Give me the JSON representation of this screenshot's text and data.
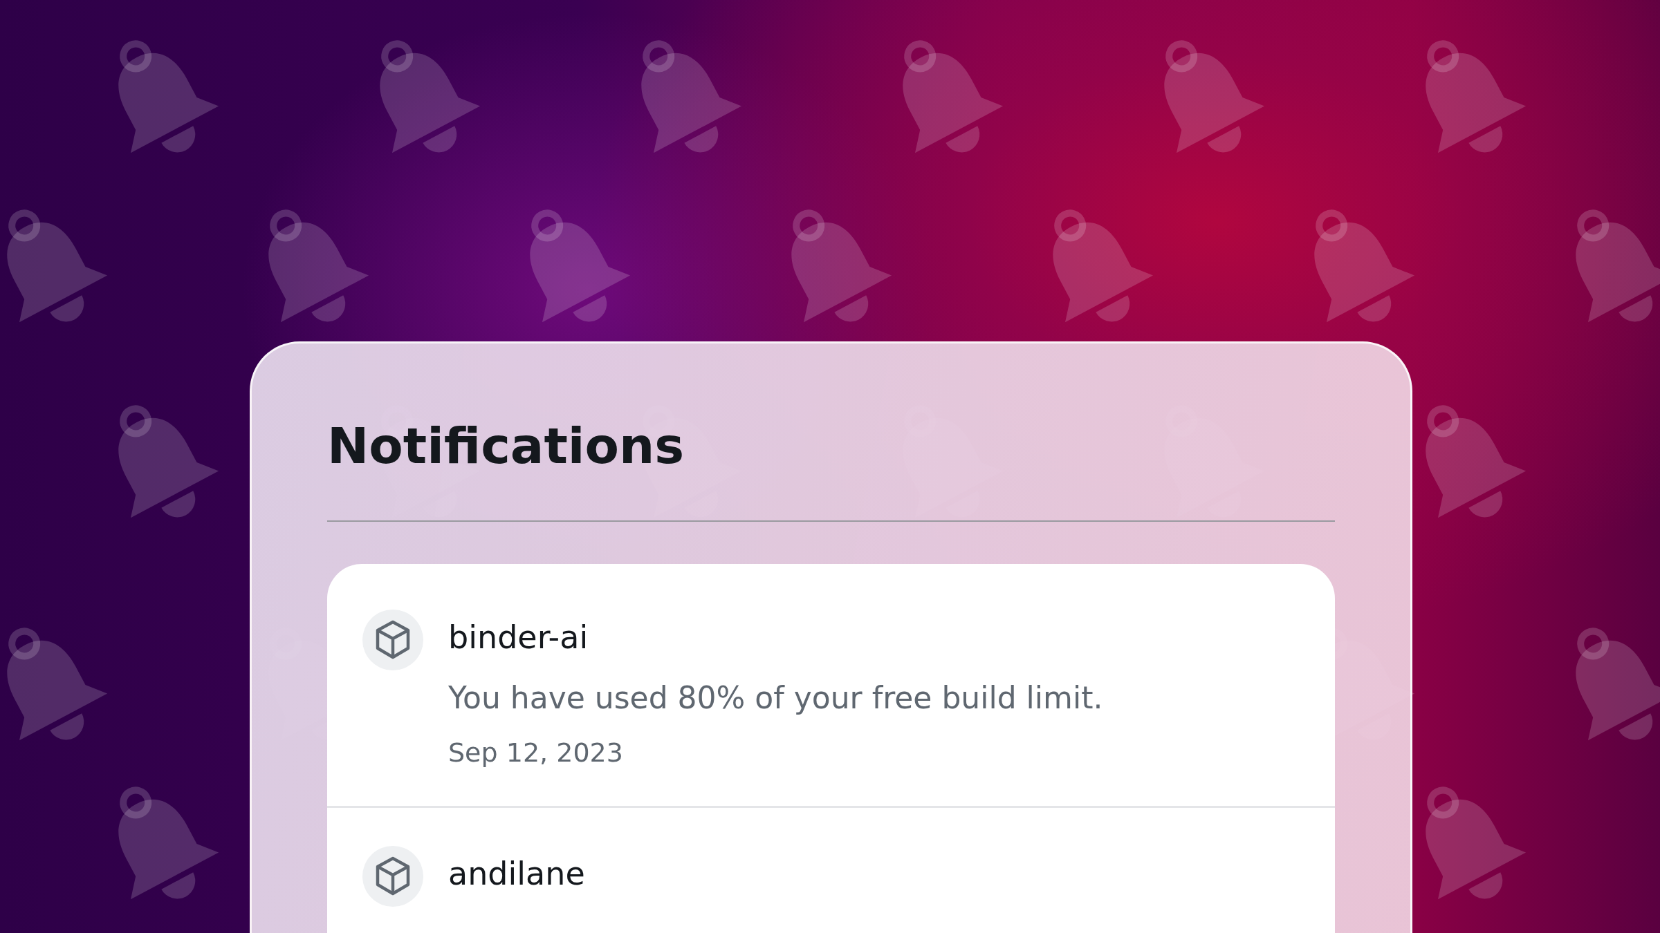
{
  "title": "Notifications",
  "notifications": [
    {
      "sender": "binder-ai",
      "message": "You have used 80% of your free build limit.",
      "date": "Sep 12, 2023"
    },
    {
      "sender": "andilane"
    }
  ]
}
